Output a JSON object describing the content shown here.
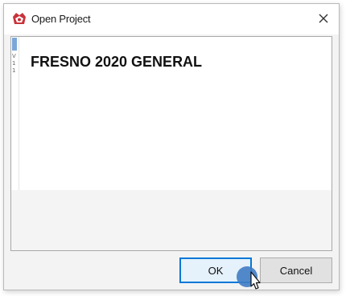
{
  "window": {
    "title": "Open Project",
    "close_glyph": "✕",
    "icon": "app-logo-icon",
    "close_icon": "close-icon"
  },
  "list": {
    "selected_item": "FRESNO 2020 GENERAL"
  },
  "buttons": {
    "ok_label": "OK",
    "cancel_label": "Cancel"
  },
  "colors": {
    "accent": "#0078d7",
    "app_icon_red": "#c8333a",
    "click_indicator": "#3f7cc4"
  },
  "cursor": {
    "icon": "mouse-pointer-icon"
  }
}
